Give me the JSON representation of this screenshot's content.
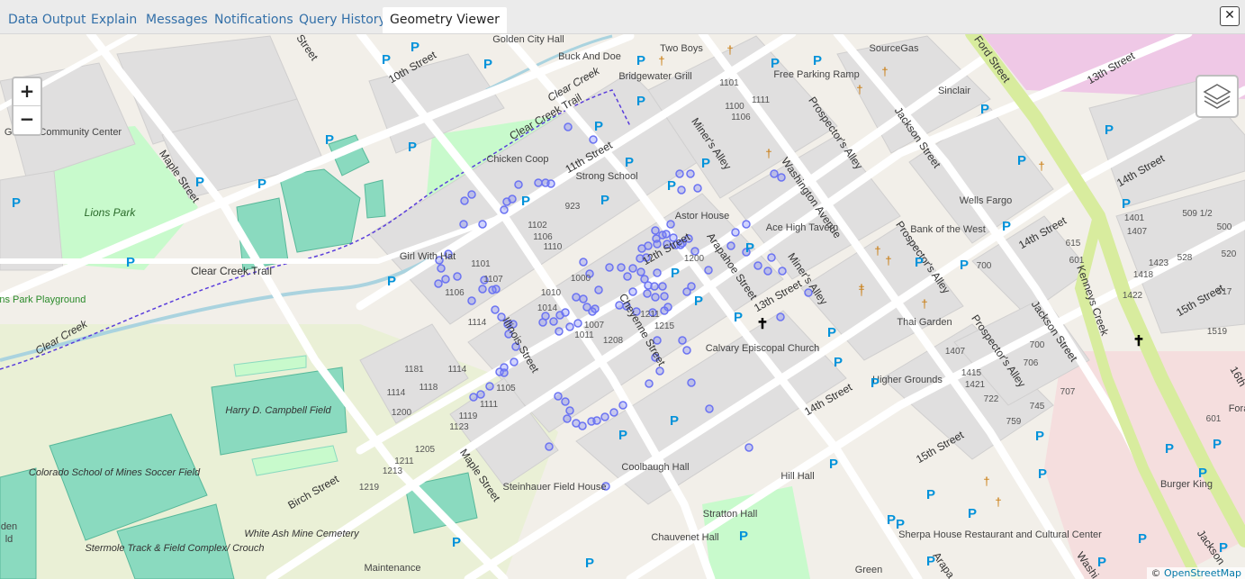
{
  "tabs": [
    {
      "label": "Data Output"
    },
    {
      "label": "Explain"
    },
    {
      "label": "Messages"
    },
    {
      "label": "Notifications"
    },
    {
      "label": "Query History"
    },
    {
      "label": "Geometry Viewer",
      "active": true
    }
  ],
  "close_label": "✕",
  "zoom": {
    "in": "+",
    "out": "−"
  },
  "attribution": {
    "prefix": "© ",
    "link": "OpenStreetMap"
  },
  "colors": {
    "point": "#6b73f2",
    "park": "#c8facc",
    "pitch": "#8adabf",
    "water": "#aad3df",
    "road_major": "#fcd6a4",
    "road_trunk": "#d8ec9e"
  },
  "labels": {
    "streets": [
      "Street",
      "10th Street",
      "11th Street",
      "Maple Street",
      "Clear Creek Trail",
      "Clear Creek Trail",
      "Miner's Alley",
      "Washington Avenue",
      "Prospector's Alley",
      "Jackson Street",
      "Ford Street",
      "13th Street",
      "14th Street",
      "14th Street",
      "15th Street",
      "Kenneys Creek",
      "13th Street",
      "12th Street",
      "Arapahoe Street",
      "Miner's Alley",
      "Cheyenne Street",
      "Illinois Street",
      "Maple Street",
      "Birch Street",
      "14th Street",
      "15th Street",
      "Prospector's Alley",
      "Prospector's Alley",
      "Jackson Street",
      "16th",
      "Clear Creek",
      "Clear Creek",
      "Arapa",
      "Washi",
      "Jackson"
    ],
    "places": [
      "Golden City Hall",
      "Buck And Doe",
      "Two Boys",
      "Bridgewater Grill",
      "SourceGas",
      "Free Parking Ramp",
      "Sinclair",
      "Golden Community Center",
      "Lions Park",
      "Lions Park Playground",
      "Chicken Coop",
      "Strong School",
      "Astor House",
      "Ace High Tavern",
      "Wells Fargo",
      "Bank of the West",
      "Girl With Hat",
      "Calvary Episcopal Church",
      "Thai Garden",
      "Higher Grounds",
      "Harry D. Campbell Field",
      "Colorado School of Mines Soccer Field",
      "Coolbaugh Hall",
      "Steinhauer Field House",
      "Hill Hall",
      "Stratton Hall",
      "Chauvenet Hall",
      "Sherpa House Restaurant and Cultural Center",
      "Burger King",
      "White Ash Mine Cemetery",
      "Stermole Track & Field Complex/ Crouch",
      "Maintenance",
      "Green",
      "den",
      "ld",
      "Fora"
    ],
    "house_numbers": [
      "1101",
      "1100",
      "1106",
      "1111",
      "1102",
      "1106",
      "1110",
      "923",
      "1101",
      "1107",
      "1106",
      "1114",
      "1119",
      "1123",
      "1118",
      "1114",
      "1181",
      "1200",
      "1205",
      "1213",
      "1211",
      "1219",
      "1114",
      "1105",
      "1111",
      "1010",
      "1014",
      "1000",
      "1007",
      "1011",
      "1208",
      "1215",
      "1211",
      "1200",
      "1401",
      "509 1/2",
      "1407",
      "500",
      "520",
      "1423",
      "528",
      "1418",
      "517",
      "1422",
      "1519",
      "615",
      "601",
      "700",
      "700",
      "706",
      "707",
      "1407",
      "1415",
      "1421",
      "722",
      "745",
      "759",
      "601"
    ]
  }
}
